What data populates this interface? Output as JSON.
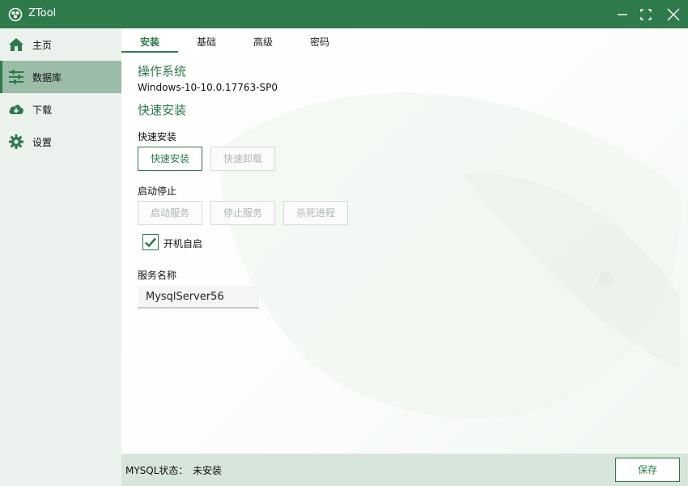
{
  "app": {
    "title": "ZTool"
  },
  "theme": {
    "primary": "#2f7a4b",
    "sidebar_bg": "#ebf1ed",
    "sidebar_active": "#9bbca6",
    "status_bg": "#d8e5db",
    "disabled_text": "#b0b8b2"
  },
  "sidebar": {
    "items": [
      {
        "label": "主页",
        "icon": "home-icon"
      },
      {
        "label": "数据库",
        "icon": "sliders-icon",
        "active": true
      },
      {
        "label": "下载",
        "icon": "cloud-download-icon"
      },
      {
        "label": "设置",
        "icon": "gear-icon"
      }
    ]
  },
  "tabs": [
    {
      "label": "安装",
      "active": true
    },
    {
      "label": "基础"
    },
    {
      "label": "高级"
    },
    {
      "label": "密码"
    }
  ],
  "install": {
    "os_title": "操作系统",
    "os_value": "Windows-10-10.0.17763-SP0",
    "quick_title": "快速安装",
    "quick_label": "快速安装",
    "quick_install_button": "快速安装",
    "quick_uninstall_button": "快速卸载",
    "startstop_label": "启动停止",
    "start_service_button": "启动服务",
    "stop_service_button": "停止服务",
    "kill_process_button": "杀死进程",
    "autostart_label": "开机自启",
    "autostart_checked": true,
    "service_name_label": "服务名称",
    "service_name_value": "MysqlServer56"
  },
  "status": {
    "label": "MYSQL状态：",
    "value": "未安装",
    "save_button": "保存"
  }
}
